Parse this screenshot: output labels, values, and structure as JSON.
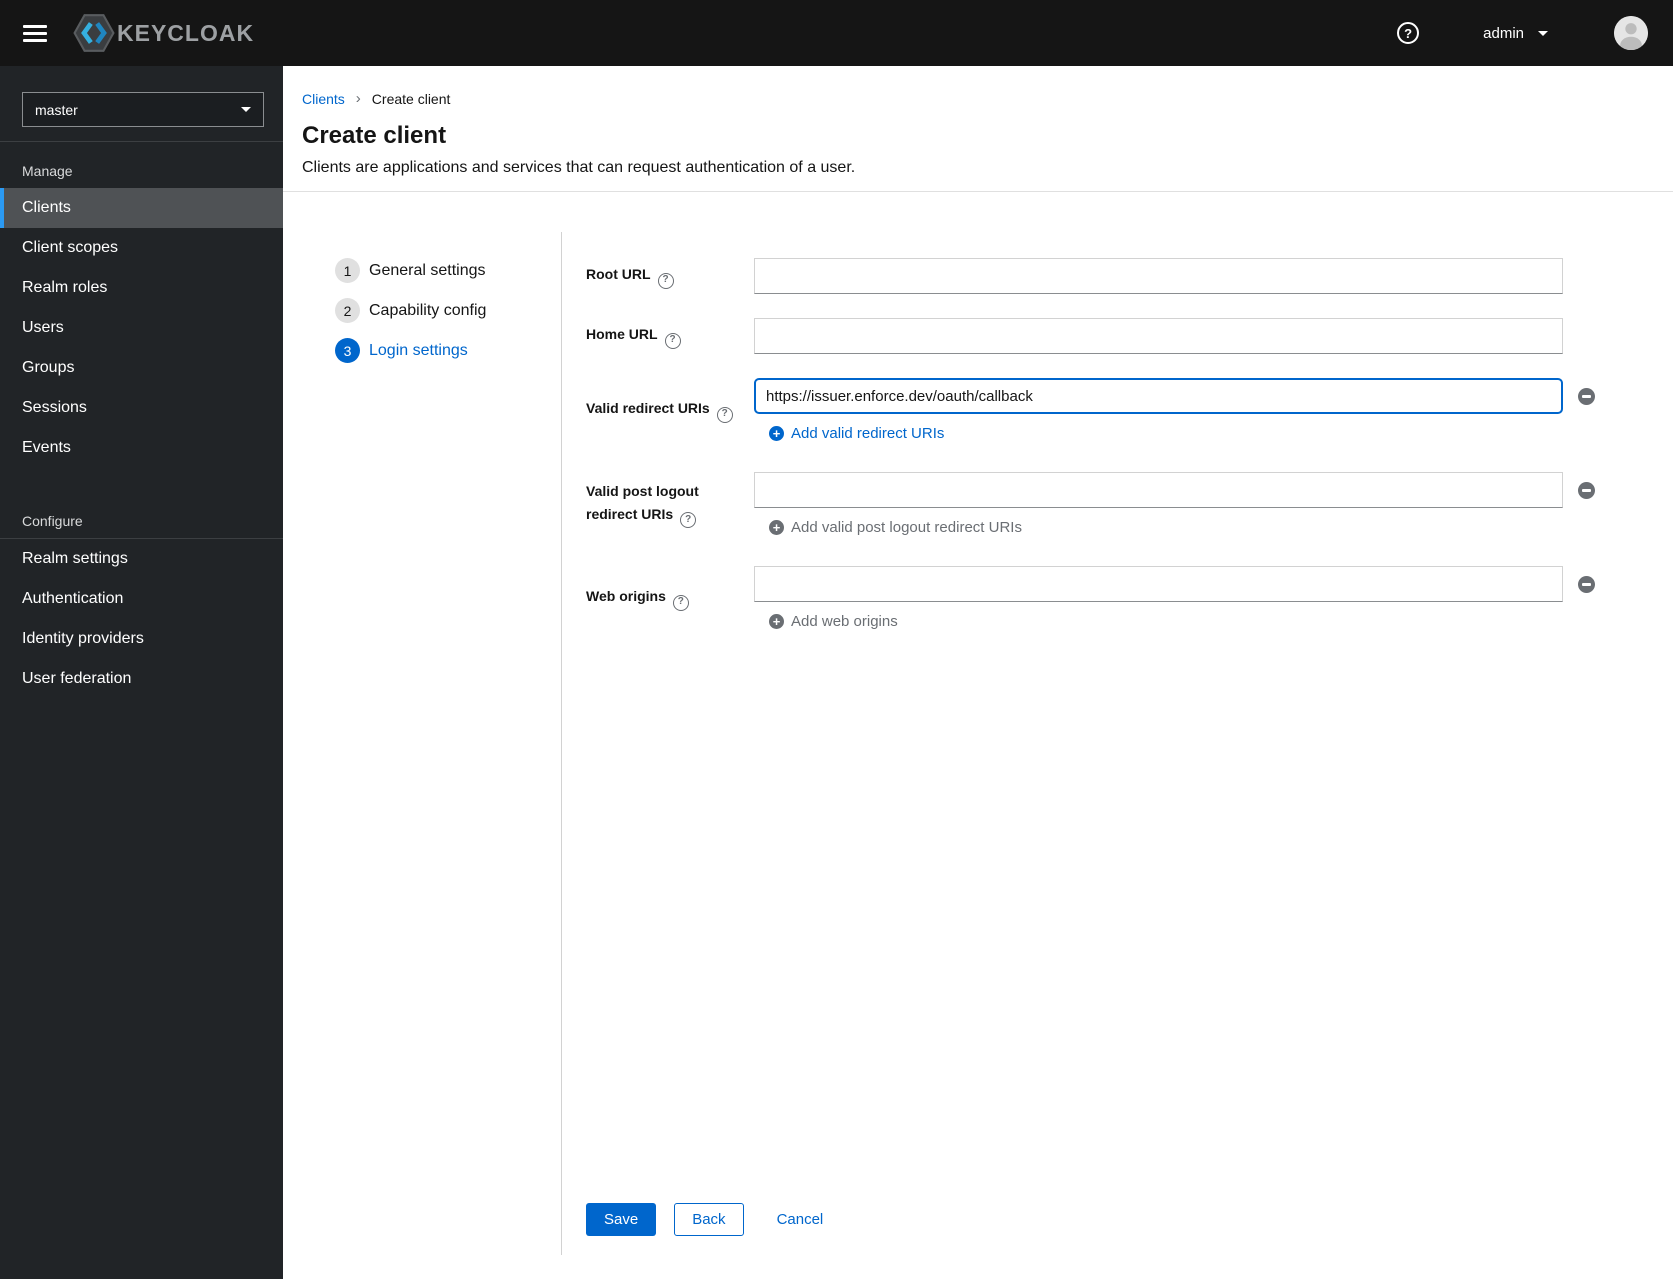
{
  "header": {
    "brand": "KEYCLOAK",
    "user": "admin"
  },
  "sidebar": {
    "realm_selector": {
      "value": "master"
    },
    "sections": [
      {
        "title": "Manage",
        "items": [
          {
            "label": "Clients",
            "active": true
          },
          {
            "label": "Client scopes"
          },
          {
            "label": "Realm roles"
          },
          {
            "label": "Users"
          },
          {
            "label": "Groups"
          },
          {
            "label": "Sessions"
          },
          {
            "label": "Events"
          }
        ]
      },
      {
        "title": "Configure",
        "items": [
          {
            "label": "Realm settings"
          },
          {
            "label": "Authentication"
          },
          {
            "label": "Identity providers"
          },
          {
            "label": "User federation"
          }
        ]
      }
    ]
  },
  "breadcrumb": {
    "items": [
      "Clients",
      "Create client"
    ],
    "separator": "›"
  },
  "page": {
    "title": "Create client",
    "subtitle": "Clients are applications and services that can request authentication of a user."
  },
  "wizard": {
    "steps": [
      {
        "number": "1",
        "label": "General settings"
      },
      {
        "number": "2",
        "label": "Capability config"
      },
      {
        "number": "3",
        "label": "Login settings"
      }
    ]
  },
  "form": {
    "root_url": {
      "label": "Root URL",
      "value": ""
    },
    "home_url": {
      "label": "Home URL",
      "value": ""
    },
    "valid_redirect_uris": {
      "label": "Valid redirect URIs",
      "value": "https://issuer.enforce.dev/oauth/callback",
      "add_label": "Add valid redirect URIs"
    },
    "post_logout_uris": {
      "label": "Valid post logout redirect URIs",
      "value": "",
      "add_label": "Add valid post logout redirect URIs"
    },
    "web_origins": {
      "label": "Web origins",
      "value": "",
      "add_label": "Add web origins"
    }
  },
  "actions": {
    "save": "Save",
    "back": "Back",
    "cancel": "Cancel"
  },
  "colors": {
    "accent": "#0066cc",
    "header_bg": "#151515",
    "sidebar_bg": "#212427",
    "sidebar_active_bg": "#4f5255",
    "sidebar_active_border": "#2b9af3",
    "muted_gray": "#6a6e73"
  }
}
